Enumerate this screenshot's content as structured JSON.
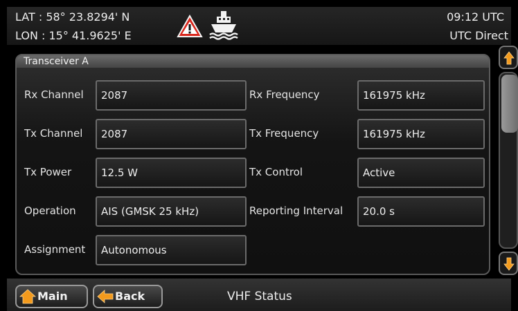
{
  "header": {
    "lat": "LAT  : 58° 23.8294' N",
    "lon": "LON : 15° 41.9625' E",
    "time": "09:12 UTC",
    "time_source": "UTC Direct",
    "icons": [
      "warning-icon",
      "ship-icon"
    ]
  },
  "panel": {
    "title": "Transceiver A",
    "rows": [
      {
        "label": "Rx Channel",
        "value": "2087",
        "label2": "Rx Frequency",
        "value2": "161975 kHz"
      },
      {
        "label": "Tx Channel",
        "value": "2087",
        "label2": "Tx Frequency",
        "value2": "161975 kHz"
      },
      {
        "label": "Tx Power",
        "value": "12.5 W",
        "label2": "Tx Control",
        "value2": "Active"
      },
      {
        "label": "Operation",
        "value": "AIS (GMSK 25 kHz)",
        "label2": "Reporting Interval",
        "value2": "20.0 s"
      },
      {
        "label": "Assignment",
        "value": "Autonomous"
      }
    ]
  },
  "footer": {
    "main_label": "Main",
    "back_label": "Back",
    "screen_title": "VHF Status"
  },
  "colors": {
    "accent": "#f39a1c",
    "warning": "#d9261c",
    "background": "#000000"
  }
}
